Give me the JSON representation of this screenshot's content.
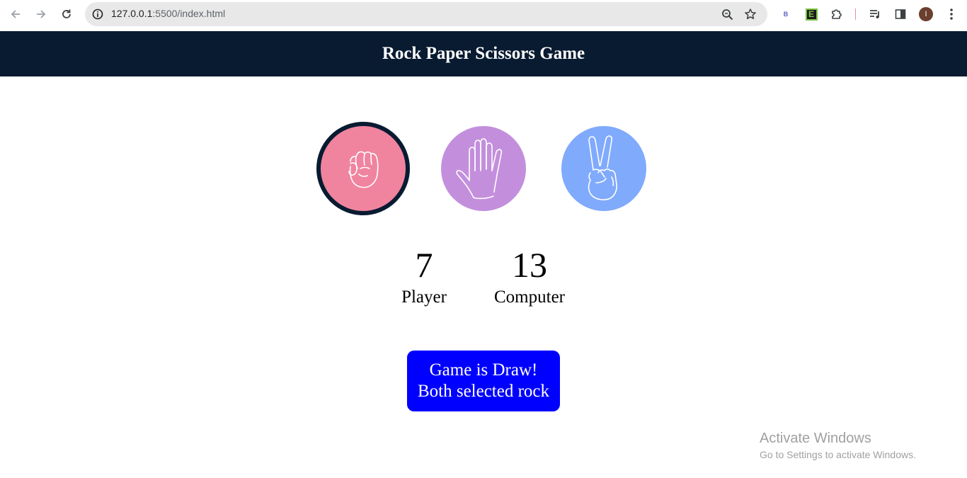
{
  "browser": {
    "url_host": "127.0.0.1",
    "url_path": ":5500/index.html",
    "icons": [
      "back-icon",
      "forward-icon",
      "reload-icon",
      "site-info-icon",
      "zoom-icon",
      "bookmark-star-icon",
      "extension-b-icon",
      "extension-e-icon",
      "extensions-puzzle-icon",
      "media-queue-icon",
      "side-panel-icon",
      "profile-avatar",
      "kebab-menu-icon"
    ],
    "ext_b_label": "B",
    "ext_e_label": "E",
    "profile_initial": "I"
  },
  "header": {
    "title": "Rock Paper Scissors Game"
  },
  "choices": [
    {
      "id": "rock",
      "color": "#f0849f",
      "selected": true
    },
    {
      "id": "paper",
      "color": "#c38fdd",
      "selected": false
    },
    {
      "id": "scissors",
      "color": "#80aafc",
      "selected": false
    }
  ],
  "score": {
    "player_value": "7",
    "player_label": "Player",
    "computer_value": "13",
    "computer_label": "Computer"
  },
  "message": {
    "line1": "Game is Draw!",
    "line2": "Both selected rock",
    "color": "#0000ff"
  },
  "watermark": {
    "title": "Activate Windows",
    "subtitle": "Go to Settings to activate Windows."
  }
}
